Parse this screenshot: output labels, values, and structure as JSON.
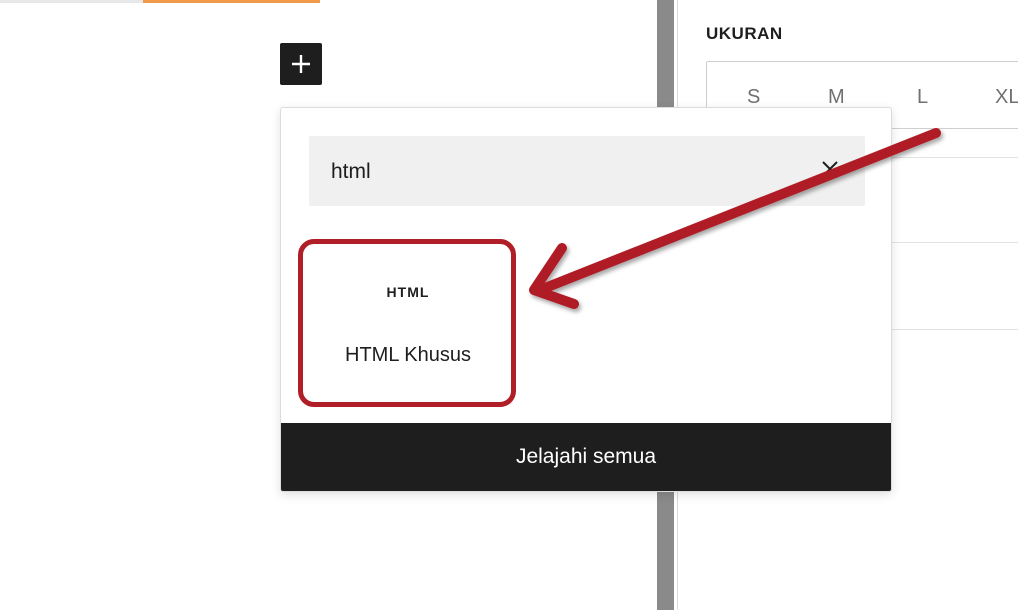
{
  "colors": {
    "accent_red": "#b01e27",
    "dark": "#1e1e1e",
    "search_bg": "#f0f0f0"
  },
  "sidebar": {
    "size_title": "UKURAN",
    "size_options": [
      "S",
      "M",
      "L",
      "XL"
    ]
  },
  "add_block": {
    "icon": "plus-icon"
  },
  "inserter": {
    "search_value": "html",
    "clear_icon": "close-icon",
    "results": [
      {
        "icon_text": "HTML",
        "label": "HTML Khusus"
      }
    ],
    "browse_all_label": "Jelajahi semua"
  }
}
